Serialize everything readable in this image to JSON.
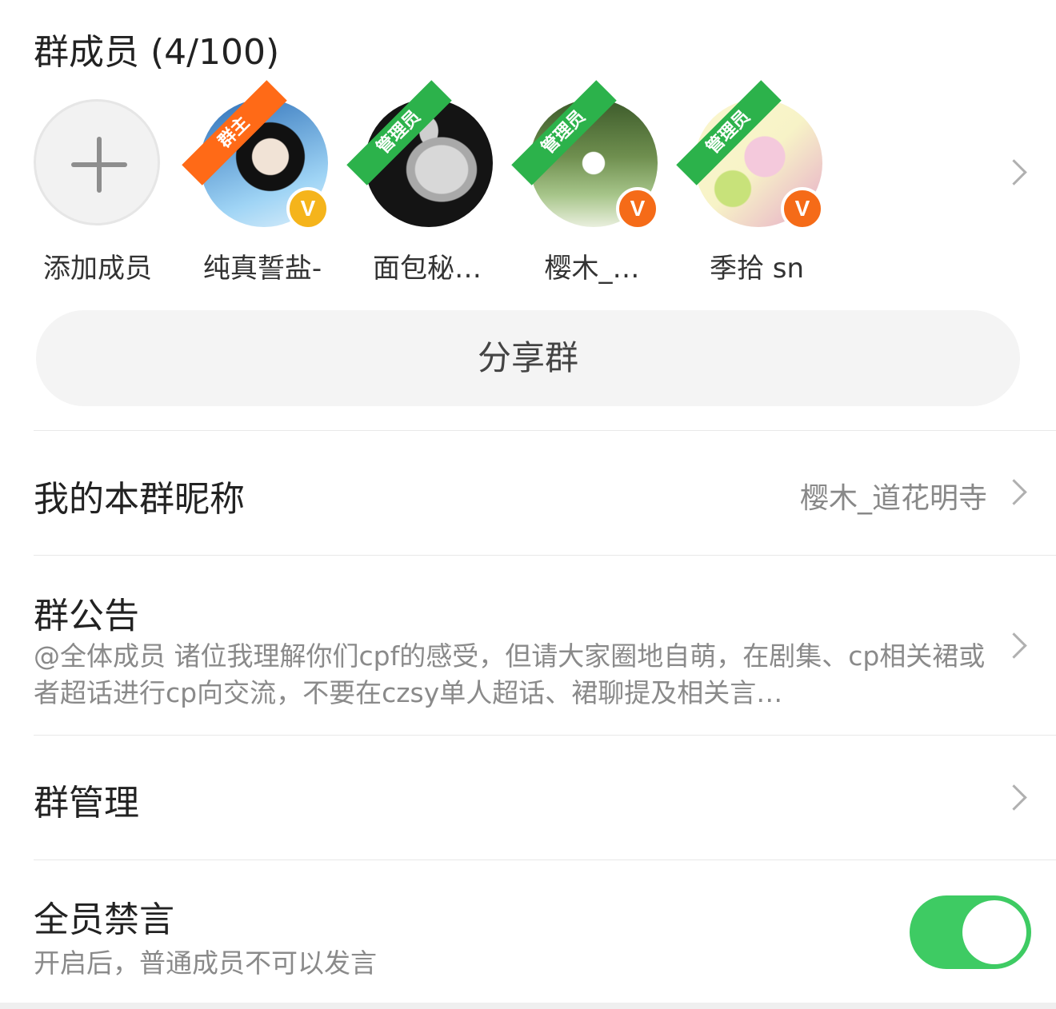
{
  "members": {
    "title": "群成员 (4/100)",
    "add_label": "添加成员",
    "list": [
      {
        "name": "纯真誓盐-",
        "role": "群主",
        "badge": "V",
        "colors": [
          "#2d6fb8",
          "#9fd4f5",
          "#111111"
        ]
      },
      {
        "name": "面包秘…",
        "role": "管理员",
        "badge": "",
        "colors": [
          "#141414",
          "#c9c9c9",
          "#2a2a2a"
        ]
      },
      {
        "name": "樱木_…",
        "role": "管理员",
        "badge": "V",
        "colors": [
          "#3c5a2a",
          "#a7c58a",
          "#ffffff"
        ]
      },
      {
        "name": "季拾 sn",
        "role": "管理员",
        "badge": "V",
        "colors": [
          "#f7f3c7",
          "#e6a9c9",
          "#b8d96a"
        ]
      }
    ]
  },
  "share": {
    "label": "分享群"
  },
  "nickname": {
    "label": "我的本群昵称",
    "value": "樱木_道花明寺"
  },
  "notice": {
    "label": "群公告",
    "text": "@全体成员 诸位我理解你们cpf的感受，但请大家圈地自萌，在剧集、cp相关裙或者超话进行cp向交流，不要在czsy单人超话、裙聊提及相关言…"
  },
  "manage": {
    "label": "群管理"
  },
  "mute": {
    "label": "全员禁言",
    "desc": "开启后，普通成员不可以发言",
    "enabled": true
  },
  "colors": {
    "accent_green": "#3ecb63",
    "owner_orange": "#ff6a17",
    "admin_green": "#2cb24b"
  }
}
